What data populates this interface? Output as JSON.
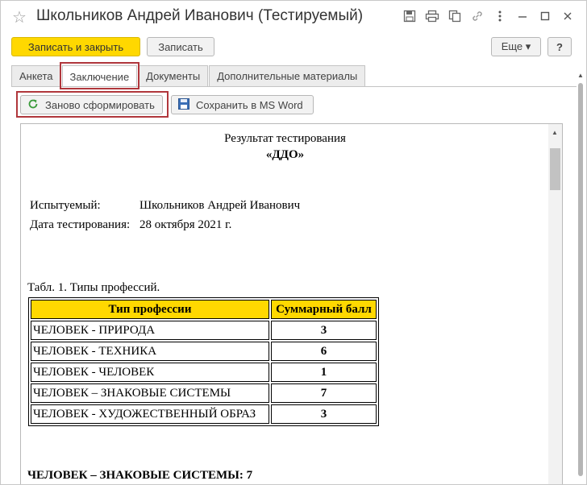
{
  "window": {
    "title": "Школьников Андрей Иванович (Тестируемый)"
  },
  "toolbar": {
    "save_close_label": "Записать и закрыть",
    "save_label": "Записать",
    "more_label": "Еще ▾",
    "help_label": "?"
  },
  "tabs": [
    {
      "label": "Анкета"
    },
    {
      "label": "Заключение"
    },
    {
      "label": "Документы"
    },
    {
      "label": "Дополнительные материалы"
    }
  ],
  "actions": {
    "regenerate_label": "Заново сформировать",
    "save_word_label": "Сохранить в MS Word"
  },
  "document": {
    "title": "Результат тестирования",
    "subtitle": "«ДДО»",
    "subject_label": "Испытуемый:",
    "subject_value": "Школьников Андрей Иванович",
    "date_label": "Дата тестирования:",
    "date_value": "28 октября 2021 г.",
    "table_caption": "Табл. 1. Типы профессий.",
    "table_headers": [
      "Тип профессии",
      "Суммарный балл"
    ],
    "table_rows": [
      [
        "ЧЕЛОВЕК - ПРИРОДА",
        "3"
      ],
      [
        "ЧЕЛОВЕК - ТЕХНИКА",
        "6"
      ],
      [
        "ЧЕЛОВЕК - ЧЕЛОВЕК",
        "1"
      ],
      [
        "ЧЕЛОВЕК – ЗНАКОВЫЕ СИСТЕМЫ",
        "7"
      ],
      [
        "ЧЕЛОВЕК - ХУДОЖЕСТВЕННЫЙ ОБРАЗ",
        "3"
      ]
    ],
    "cut_line": "ЧЕЛОВЕК – ЗНАКОВЫЕ СИСТЕМЫ: 7"
  },
  "colors": {
    "accent": "#ffd800",
    "highlight": "#b0373c"
  }
}
